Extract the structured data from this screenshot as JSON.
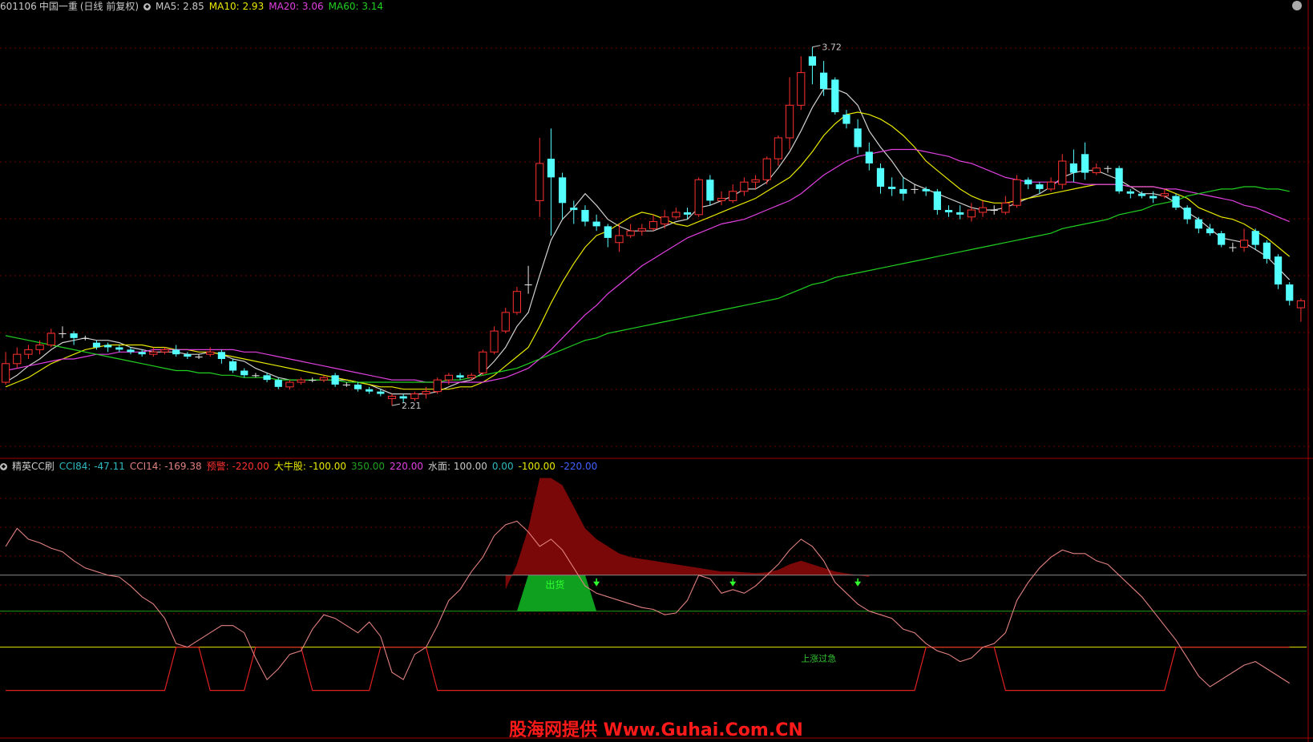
{
  "header": {
    "stock_code": "601106",
    "stock_name": "中国一重",
    "period": "(日线 前复权)",
    "ma": [
      {
        "label": "MA5: 2.85",
        "color": "#c8c8c8"
      },
      {
        "label": "MA10: 2.93",
        "color": "#e8e800"
      },
      {
        "label": "MA20: 3.06",
        "color": "#e040e0"
      },
      {
        "label": "MA60: 3.14",
        "color": "#20d020"
      }
    ]
  },
  "sub_header": {
    "name": "精英CC刷",
    "items": [
      {
        "label": "CCI84: -47.11",
        "color": "#30b8c0"
      },
      {
        "label": "CCI14: -169.38",
        "color": "#e08080"
      },
      {
        "label": "预警: -220.00",
        "color": "#ff3030"
      },
      {
        "label": "大牛股: -100.00",
        "color": "#e8e800"
      },
      {
        "label": "350.00",
        "color": "#20a020"
      },
      {
        "label": "220.00",
        "color": "#e040e0"
      },
      {
        "label": "水面: 100.00",
        "color": "#c8c8c8"
      },
      {
        "label": "0.00",
        "color": "#30b8c0"
      },
      {
        "label": "-100.00",
        "color": "#e8e800"
      },
      {
        "label": "-220.00",
        "color": "#4060ff"
      }
    ]
  },
  "chart_data": {
    "type": "candlestick",
    "price_range": [
      2.0,
      3.9
    ],
    "candles": [
      [
        2.32,
        2.4,
        2.45,
        2.31
      ],
      [
        2.4,
        2.44,
        2.47,
        2.38
      ],
      [
        2.44,
        2.46,
        2.48,
        2.42
      ],
      [
        2.46,
        2.48,
        2.5,
        2.44
      ],
      [
        2.48,
        2.53,
        2.55,
        2.47
      ],
      [
        2.53,
        2.53,
        2.56,
        2.51
      ],
      [
        2.53,
        2.51,
        2.54,
        2.48
      ],
      [
        2.51,
        2.51,
        2.52,
        2.5
      ],
      [
        2.49,
        2.47,
        2.5,
        2.46
      ],
      [
        2.48,
        2.47,
        2.49,
        2.45
      ],
      [
        2.47,
        2.46,
        2.48,
        2.45
      ],
      [
        2.46,
        2.45,
        2.47,
        2.44
      ],
      [
        2.45,
        2.44,
        2.46,
        2.43
      ],
      [
        2.44,
        2.45,
        2.47,
        2.43
      ],
      [
        2.45,
        2.46,
        2.47,
        2.44
      ],
      [
        2.46,
        2.44,
        2.48,
        2.43
      ],
      [
        2.44,
        2.43,
        2.45,
        2.42
      ],
      [
        2.43,
        2.43,
        2.44,
        2.42
      ],
      [
        2.44,
        2.45,
        2.47,
        2.43
      ],
      [
        2.45,
        2.42,
        2.46,
        2.4
      ],
      [
        2.41,
        2.37,
        2.42,
        2.36
      ],
      [
        2.37,
        2.35,
        2.38,
        2.34
      ],
      [
        2.35,
        2.35,
        2.36,
        2.34
      ],
      [
        2.35,
        2.33,
        2.36,
        2.32
      ],
      [
        2.33,
        2.3,
        2.34,
        2.29
      ],
      [
        2.3,
        2.32,
        2.33,
        2.29
      ],
      [
        2.32,
        2.33,
        2.34,
        2.31
      ],
      [
        2.33,
        2.33,
        2.34,
        2.32
      ],
      [
        2.33,
        2.34,
        2.35,
        2.32
      ],
      [
        2.35,
        2.31,
        2.36,
        2.3
      ],
      [
        2.31,
        2.31,
        2.32,
        2.3
      ],
      [
        2.31,
        2.29,
        2.32,
        2.28
      ],
      [
        2.29,
        2.28,
        2.3,
        2.27
      ],
      [
        2.28,
        2.27,
        2.29,
        2.26
      ],
      [
        2.25,
        2.26,
        2.27,
        2.22
      ],
      [
        2.26,
        2.25,
        2.27,
        2.23
      ],
      [
        2.25,
        2.27,
        2.28,
        2.24
      ],
      [
        2.27,
        2.28,
        2.3,
        2.25
      ],
      [
        2.28,
        2.33,
        2.34,
        2.27
      ],
      [
        2.33,
        2.35,
        2.36,
        2.31
      ],
      [
        2.35,
        2.34,
        2.36,
        2.33
      ],
      [
        2.34,
        2.35,
        2.36,
        2.33
      ],
      [
        2.36,
        2.45,
        2.46,
        2.35
      ],
      [
        2.45,
        2.54,
        2.56,
        2.44
      ],
      [
        2.54,
        2.62,
        2.64,
        2.53
      ],
      [
        2.62,
        2.71,
        2.73,
        2.61
      ],
      [
        2.74,
        2.74,
        2.82,
        2.7
      ],
      [
        3.1,
        3.26,
        3.37,
        3.03
      ],
      [
        3.28,
        3.2,
        3.41,
        2.95
      ],
      [
        3.2,
        3.09,
        3.22,
        3.02
      ],
      [
        3.07,
        3.06,
        3.1,
        3.0
      ],
      [
        3.06,
        3.01,
        3.08,
        2.99
      ],
      [
        3.01,
        2.99,
        3.04,
        2.97
      ],
      [
        2.99,
        2.94,
        3.0,
        2.9
      ],
      [
        2.92,
        2.95,
        3.0,
        2.88
      ],
      [
        2.95,
        2.97,
        3.0,
        2.94
      ],
      [
        2.97,
        2.98,
        3.0,
        2.95
      ],
      [
        2.98,
        3.01,
        3.04,
        2.97
      ],
      [
        3.0,
        3.03,
        3.06,
        2.98
      ],
      [
        3.03,
        3.05,
        3.07,
        3.02
      ],
      [
        3.05,
        3.04,
        3.07,
        3.02
      ],
      [
        3.04,
        3.19,
        3.2,
        3.03
      ],
      [
        3.19,
        3.1,
        3.21,
        3.08
      ],
      [
        3.1,
        3.11,
        3.14,
        3.08
      ],
      [
        3.1,
        3.14,
        3.17,
        3.09
      ],
      [
        3.14,
        3.18,
        3.2,
        3.12
      ],
      [
        3.18,
        3.19,
        3.21,
        3.15
      ],
      [
        3.19,
        3.28,
        3.29,
        3.17
      ],
      [
        3.28,
        3.37,
        3.38,
        3.25
      ],
      [
        3.37,
        3.51,
        3.63,
        3.32
      ],
      [
        3.51,
        3.65,
        3.72,
        3.49
      ],
      [
        3.72,
        3.68,
        3.76,
        3.6
      ],
      [
        3.65,
        3.58,
        3.7,
        3.55
      ],
      [
        3.62,
        3.48,
        3.63,
        3.47
      ],
      [
        3.47,
        3.43,
        3.49,
        3.41
      ],
      [
        3.41,
        3.33,
        3.45,
        3.3
      ],
      [
        3.31,
        3.26,
        3.35,
        3.23
      ],
      [
        3.24,
        3.16,
        3.26,
        3.13
      ],
      [
        3.16,
        3.15,
        3.2,
        3.12
      ],
      [
        3.15,
        3.13,
        3.2,
        3.1
      ],
      [
        3.15,
        3.15,
        3.17,
        3.13
      ],
      [
        3.15,
        3.14,
        3.16,
        3.12
      ],
      [
        3.14,
        3.06,
        3.15,
        3.04
      ],
      [
        3.06,
        3.05,
        3.08,
        3.03
      ],
      [
        3.05,
        3.04,
        3.08,
        3.02
      ],
      [
        3.03,
        3.06,
        3.09,
        3.01
      ],
      [
        3.05,
        3.07,
        3.1,
        3.03
      ],
      [
        3.06,
        3.06,
        3.08,
        3.04
      ],
      [
        3.05,
        3.09,
        3.12,
        3.04
      ],
      [
        3.08,
        3.19,
        3.21,
        3.07
      ],
      [
        3.19,
        3.17,
        3.2,
        3.15
      ],
      [
        3.17,
        3.15,
        3.18,
        3.13
      ],
      [
        3.15,
        3.18,
        3.2,
        3.14
      ],
      [
        3.17,
        3.27,
        3.3,
        3.15
      ],
      [
        3.26,
        3.22,
        3.32,
        3.18
      ],
      [
        3.3,
        3.22,
        3.35,
        3.19
      ],
      [
        3.22,
        3.24,
        3.26,
        3.21
      ],
      [
        3.24,
        3.24,
        3.25,
        3.22
      ],
      [
        3.24,
        3.14,
        3.25,
        3.13
      ],
      [
        3.14,
        3.13,
        3.15,
        3.11
      ],
      [
        3.13,
        3.12,
        3.14,
        3.11
      ],
      [
        3.12,
        3.11,
        3.14,
        3.09
      ],
      [
        3.12,
        3.13,
        3.15,
        3.11
      ],
      [
        3.12,
        3.07,
        3.13,
        3.06
      ],
      [
        3.07,
        3.02,
        3.08,
        3.0
      ],
      [
        3.02,
        2.98,
        3.03,
        2.96
      ],
      [
        2.98,
        2.96,
        3.0,
        2.95
      ],
      [
        2.96,
        2.91,
        2.97,
        2.9
      ],
      [
        2.9,
        2.9,
        2.92,
        2.88
      ],
      [
        2.9,
        2.93,
        2.98,
        2.88
      ],
      [
        2.97,
        2.91,
        2.98,
        2.89
      ],
      [
        2.92,
        2.85,
        2.93,
        2.83
      ],
      [
        2.86,
        2.74,
        2.87,
        2.72
      ],
      [
        2.74,
        2.67,
        2.75,
        2.65
      ],
      [
        2.64,
        2.67,
        2.68,
        2.58
      ]
    ],
    "ma_lines": [
      {
        "name": "MA5",
        "color": "#d0d0d0",
        "values": [
          2.32,
          2.35,
          2.39,
          2.42,
          2.46,
          2.49,
          2.5,
          2.51,
          2.5,
          2.5,
          2.49,
          2.47,
          2.46,
          2.45,
          2.45,
          2.45,
          2.44,
          2.44,
          2.45,
          2.44,
          2.42,
          2.41,
          2.38,
          2.36,
          2.34,
          2.33,
          2.33,
          2.33,
          2.33,
          2.33,
          2.33,
          2.32,
          2.31,
          2.29,
          2.27,
          2.27,
          2.27,
          2.27,
          2.28,
          2.3,
          2.32,
          2.33,
          2.36,
          2.41,
          2.47,
          2.56,
          2.62,
          2.78,
          2.93,
          3.02,
          3.07,
          3.13,
          3.08,
          3.02,
          2.99,
          2.97,
          2.97,
          2.97,
          2.99,
          3.01,
          3.02,
          3.07,
          3.08,
          3.1,
          3.12,
          3.15,
          3.15,
          3.18,
          3.24,
          3.31,
          3.4,
          3.5,
          3.58,
          3.58,
          3.56,
          3.51,
          3.4,
          3.33,
          3.27,
          3.2,
          3.17,
          3.15,
          3.13,
          3.11,
          3.09,
          3.07,
          3.06,
          3.06,
          3.07,
          3.09,
          3.11,
          3.13,
          3.16,
          3.2,
          3.22,
          3.23,
          3.23,
          3.21,
          3.19,
          3.16,
          3.13,
          3.13,
          3.12,
          3.09,
          3.05,
          3.02,
          2.98,
          2.94,
          2.93,
          2.92,
          2.89,
          2.86,
          2.81,
          2.76
        ]
      },
      {
        "name": "MA10",
        "color": "#e8e800",
        "values": [
          2.3,
          2.32,
          2.34,
          2.37,
          2.4,
          2.42,
          2.44,
          2.46,
          2.47,
          2.48,
          2.48,
          2.48,
          2.48,
          2.47,
          2.47,
          2.46,
          2.46,
          2.45,
          2.45,
          2.44,
          2.43,
          2.42,
          2.41,
          2.4,
          2.39,
          2.38,
          2.37,
          2.36,
          2.35,
          2.34,
          2.33,
          2.32,
          2.31,
          2.3,
          2.3,
          2.29,
          2.29,
          2.29,
          2.29,
          2.29,
          2.3,
          2.3,
          2.32,
          2.35,
          2.39,
          2.43,
          2.47,
          2.56,
          2.66,
          2.75,
          2.83,
          2.9,
          2.95,
          2.97,
          3.0,
          3.03,
          3.05,
          3.04,
          3.02,
          3.0,
          2.99,
          3.01,
          3.03,
          3.05,
          3.07,
          3.09,
          3.11,
          3.14,
          3.17,
          3.2,
          3.25,
          3.31,
          3.38,
          3.43,
          3.47,
          3.48,
          3.47,
          3.45,
          3.42,
          3.38,
          3.33,
          3.27,
          3.23,
          3.19,
          3.15,
          3.12,
          3.1,
          3.09,
          3.09,
          3.1,
          3.11,
          3.12,
          3.13,
          3.14,
          3.15,
          3.16,
          3.17,
          3.17,
          3.17,
          3.16,
          3.16,
          3.16,
          3.15,
          3.13,
          3.11,
          3.07,
          3.05,
          3.03,
          3.02,
          3.0,
          2.97,
          2.94,
          2.9,
          2.86
        ]
      },
      {
        "name": "MA20",
        "color": "#e040e0",
        "values": [
          2.37,
          2.38,
          2.39,
          2.4,
          2.41,
          2.42,
          2.42,
          2.43,
          2.44,
          2.44,
          2.45,
          2.45,
          2.45,
          2.46,
          2.46,
          2.46,
          2.46,
          2.46,
          2.46,
          2.46,
          2.46,
          2.45,
          2.45,
          2.44,
          2.43,
          2.42,
          2.41,
          2.4,
          2.39,
          2.38,
          2.37,
          2.36,
          2.35,
          2.34,
          2.33,
          2.33,
          2.33,
          2.32,
          2.32,
          2.32,
          2.32,
          2.32,
          2.32,
          2.33,
          2.34,
          2.36,
          2.38,
          2.42,
          2.46,
          2.51,
          2.56,
          2.61,
          2.65,
          2.7,
          2.74,
          2.78,
          2.82,
          2.85,
          2.88,
          2.91,
          2.94,
          2.96,
          2.98,
          3.0,
          3.01,
          3.02,
          3.04,
          3.06,
          3.08,
          3.1,
          3.13,
          3.17,
          3.21,
          3.24,
          3.27,
          3.29,
          3.3,
          3.31,
          3.32,
          3.32,
          3.32,
          3.31,
          3.3,
          3.29,
          3.27,
          3.26,
          3.24,
          3.22,
          3.2,
          3.19,
          3.18,
          3.18,
          3.18,
          3.18,
          3.18,
          3.17,
          3.17,
          3.17,
          3.17,
          3.16,
          3.16,
          3.16,
          3.15,
          3.15,
          3.14,
          3.13,
          3.12,
          3.11,
          3.1,
          3.08,
          3.07,
          3.05,
          3.03,
          3.01
        ]
      },
      {
        "name": "MA60",
        "color": "#20d020",
        "values": [
          2.52,
          2.51,
          2.5,
          2.49,
          2.48,
          2.47,
          2.46,
          2.45,
          2.44,
          2.43,
          2.42,
          2.41,
          2.4,
          2.39,
          2.38,
          2.37,
          2.37,
          2.36,
          2.36,
          2.35,
          2.35,
          2.34,
          2.34,
          2.34,
          2.33,
          2.33,
          2.33,
          2.33,
          2.33,
          2.33,
          2.32,
          2.32,
          2.32,
          2.32,
          2.32,
          2.32,
          2.32,
          2.32,
          2.32,
          2.33,
          2.33,
          2.34,
          2.35,
          2.36,
          2.37,
          2.38,
          2.4,
          2.42,
          2.44,
          2.46,
          2.48,
          2.5,
          2.51,
          2.53,
          2.54,
          2.55,
          2.56,
          2.57,
          2.58,
          2.59,
          2.6,
          2.61,
          2.62,
          2.63,
          2.64,
          2.65,
          2.66,
          2.67,
          2.68,
          2.7,
          2.72,
          2.74,
          2.75,
          2.77,
          2.78,
          2.79,
          2.8,
          2.81,
          2.82,
          2.83,
          2.84,
          2.85,
          2.86,
          2.87,
          2.88,
          2.89,
          2.9,
          2.91,
          2.92,
          2.93,
          2.94,
          2.95,
          2.96,
          2.98,
          2.99,
          3.0,
          3.01,
          3.02,
          3.04,
          3.05,
          3.06,
          3.08,
          3.09,
          3.1,
          3.12,
          3.13,
          3.14,
          3.15,
          3.15,
          3.16,
          3.16,
          3.15,
          3.15,
          3.14
        ]
      }
    ],
    "annotations": [
      {
        "label": "3.72",
        "index": 71,
        "price": 3.76
      },
      {
        "label": "2.21",
        "index": 34,
        "price": 2.22
      }
    ],
    "oscillator": {
      "range": [
        -350,
        380
      ],
      "levels": {
        "water": 100,
        "zero": 0,
        "bull": -100,
        "warn": -220
      },
      "cci14": [
        180,
        230,
        200,
        190,
        175,
        165,
        140,
        120,
        110,
        100,
        95,
        70,
        40,
        20,
        -20,
        -90,
        -100,
        -80,
        -60,
        -40,
        -40,
        -60,
        -130,
        -190,
        -160,
        -120,
        -110,
        -50,
        -10,
        -20,
        -40,
        -60,
        -30,
        -70,
        -170,
        -190,
        -120,
        -100,
        -40,
        30,
        60,
        110,
        150,
        210,
        240,
        250,
        220,
        180,
        200,
        170,
        120,
        70,
        50,
        40,
        30,
        20,
        10,
        5,
        -10,
        -5,
        30,
        100,
        90,
        50,
        60,
        50,
        70,
        100,
        130,
        170,
        200,
        180,
        140,
        80,
        50,
        20,
        0,
        -10,
        -20,
        -50,
        -60,
        -90,
        -110,
        -120,
        -140,
        -130,
        -100,
        -90,
        -60,
        30,
        80,
        120,
        150,
        170,
        160,
        160,
        140,
        130,
        100,
        70,
        40,
        0,
        -40,
        -80,
        -130,
        -180,
        -210,
        -190,
        -170,
        -150,
        -140,
        -160,
        -180,
        -200
      ]
    },
    "labels": {
      "sell_label": "出货",
      "rise_label": "上涨过急"
    }
  },
  "watermark": "股海网提供 Www.Guhai.Com.CN"
}
